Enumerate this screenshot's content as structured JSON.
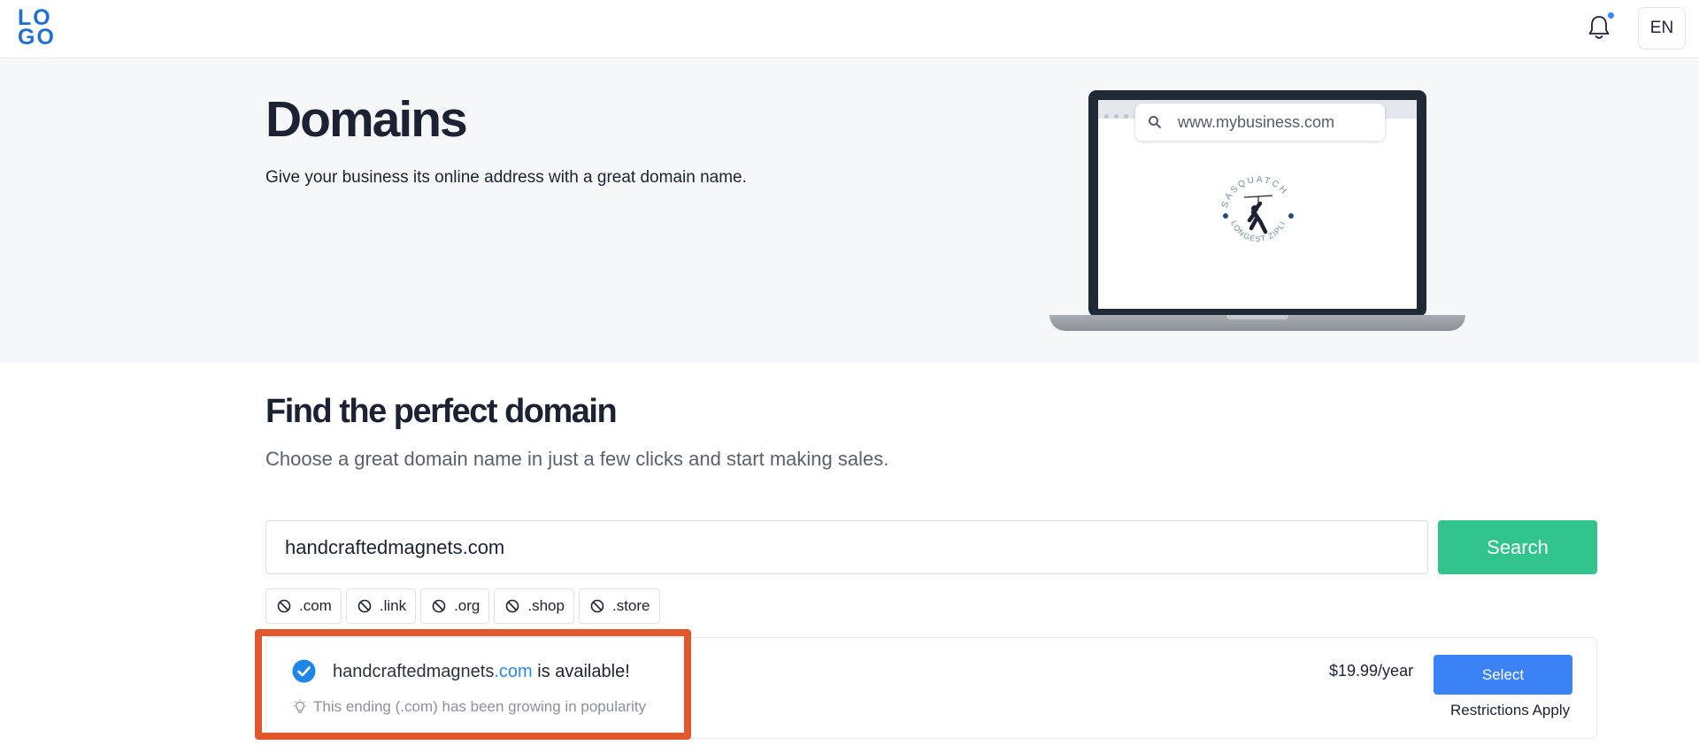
{
  "header": {
    "logo_top": "LO",
    "logo_bottom": "GO",
    "language": "EN",
    "notification_dot_color": "#2f8bff"
  },
  "hero": {
    "title": "Domains",
    "subtitle": "Give your business its online address with a great domain name.",
    "illustration": {
      "url_text": "www.mybusiness.com",
      "badge_top": "SASQUATCH",
      "badge_bottom": "LONGEST ZIPLINE"
    }
  },
  "find": {
    "title": "Find the perfect domain",
    "subtitle": "Choose a great domain name in just a few clicks and start making sales."
  },
  "search": {
    "value": "handcraftedmagnets.com",
    "button_label": "Search",
    "button_color": "#31c48d"
  },
  "tld_filters": [
    {
      "label": ".com"
    },
    {
      "label": ".link"
    },
    {
      "label": ".org"
    },
    {
      "label": ".shop"
    },
    {
      "label": ".store"
    }
  ],
  "result": {
    "domain_name": "handcraftedmagnets",
    "tld": ".com",
    "status": " is available!",
    "hint": "This ending (.com) has been growing in popularity",
    "price": "$19.99/year",
    "select_label": "Select",
    "restrictions": "Restrictions Apply",
    "tld_color": "#2b8be0",
    "select_color": "#3b82f6"
  },
  "highlight_color": "#e2572e"
}
